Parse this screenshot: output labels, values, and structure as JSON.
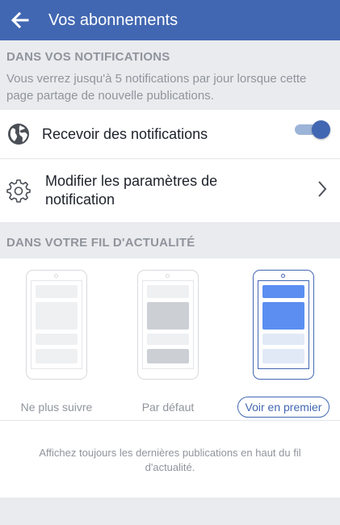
{
  "header": {
    "title": "Vos abonnements",
    "back_icon": "arrow-left-icon"
  },
  "notifications_section": {
    "title": "DANS VOS NOTIFICATIONS",
    "description": "Vous verrez jusqu'à 5 notifications par jour lorsque cette page partage de nouvelle publications."
  },
  "receive_row": {
    "icon": "globe-icon",
    "label": "Recevoir des notifications",
    "toggle_on": true
  },
  "settings_row": {
    "icon": "gear-icon",
    "label_line1": "Modifier les paramètres de",
    "label_line2": "notification",
    "chevron_icon": "chevron-right-icon"
  },
  "feed_section": {
    "title": "DANS VOTRE FIL D'ACTUALITÉ"
  },
  "feed_options": [
    {
      "label": "Ne plus suivre",
      "selected": false
    },
    {
      "label": "Par défaut",
      "selected": false
    },
    {
      "label": "Voir en premier",
      "selected": true
    }
  ],
  "feed_footnote": "Affichez toujours les dernières publications en haut du fil d'actualité.",
  "colors": {
    "brand_blue": "#4267b2",
    "selected_blue": "#5b8ef0",
    "background_gray": "#e9ebee",
    "muted_text": "#90949c"
  }
}
